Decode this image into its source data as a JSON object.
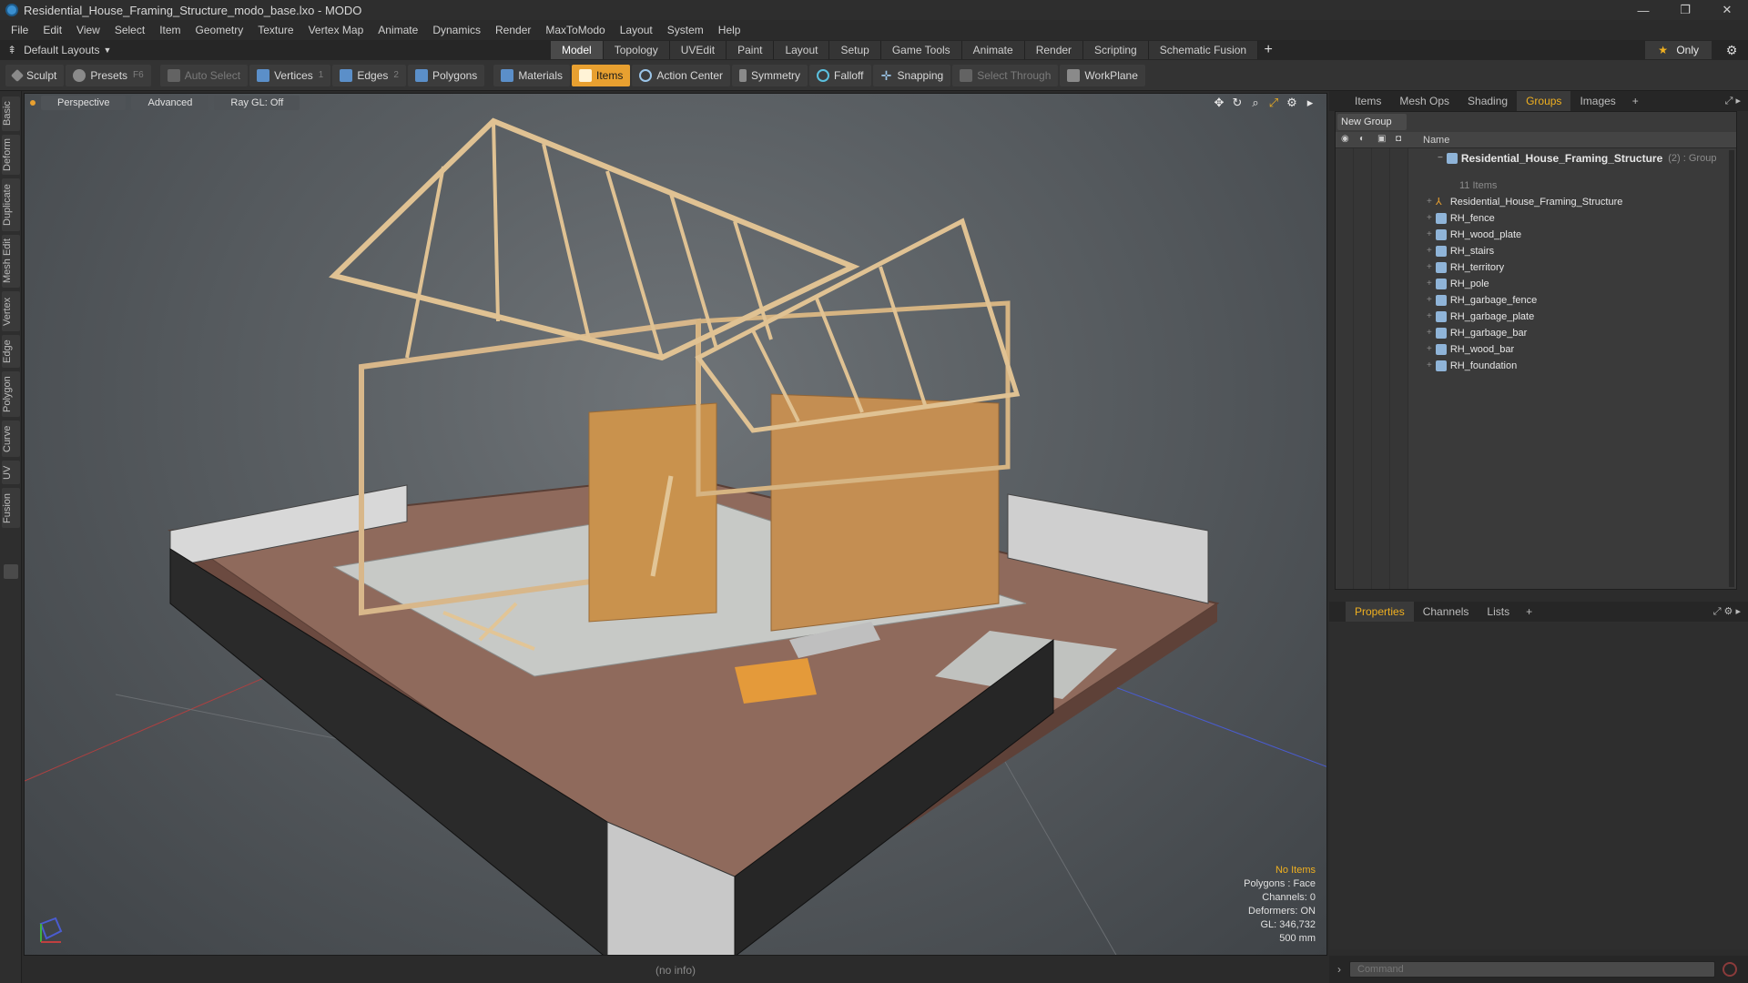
{
  "window": {
    "title": "Residential_House_Framing_Structure_modo_base.lxo - MODO",
    "minimize": "—",
    "restore": "❐",
    "close": "✕"
  },
  "menu": [
    "File",
    "Edit",
    "View",
    "Select",
    "Item",
    "Geometry",
    "Texture",
    "Vertex Map",
    "Animate",
    "Dynamics",
    "Render",
    "MaxToModo",
    "Layout",
    "System",
    "Help"
  ],
  "layout_bar": {
    "layout_name": "Default Layouts",
    "modes": [
      "Model",
      "Topology",
      "UVEdit",
      "Paint",
      "Layout",
      "Setup",
      "Game Tools",
      "Animate",
      "Render",
      "Scripting",
      "Schematic Fusion"
    ],
    "active_mode": "Model",
    "add_label": "+",
    "only_label": "Only"
  },
  "toolbar": {
    "sculpt": "Sculpt",
    "presets": "Presets",
    "presets_key": "F6",
    "auto_select": "Auto Select",
    "vertices": "Vertices",
    "vertices_key": "1",
    "edges": "Edges",
    "edges_key": "2",
    "polygons": "Polygons",
    "materials": "Materials",
    "items": "Items",
    "action_center": "Action Center",
    "symmetry": "Symmetry",
    "falloff": "Falloff",
    "snapping": "Snapping",
    "select_through": "Select Through",
    "workplane": "WorkPlane"
  },
  "left_tabs": [
    "Basic",
    "Deform",
    "Duplicate",
    "Mesh Edit",
    "Vertex",
    "Edge",
    "Polygon",
    "Curve",
    "UV",
    "Fusion"
  ],
  "viewport": {
    "view_mode": "Perspective",
    "shading": "Advanced",
    "raygl": "Ray GL: Off",
    "info": {
      "selection": "No Items",
      "polygons": "Polygons : Face",
      "channels": "Channels: 0",
      "deformers": "Deformers: ON",
      "gl": "GL: 346,732",
      "scale": "500 mm"
    }
  },
  "status": {
    "info": "(no info)"
  },
  "right_panel": {
    "tabs": [
      "Items",
      "Mesh Ops",
      "Shading",
      "Groups",
      "Images"
    ],
    "active_tab": "Groups",
    "new_group": "New Group",
    "name_col": "Name",
    "group": {
      "name": "Residential_House_Framing_Structure",
      "suffix": "(2) : Group",
      "count": "11 Items"
    },
    "items": [
      {
        "name": "Residential_House_Framing_Structure",
        "icon": "locator-icon"
      },
      {
        "name": "RH_fence",
        "icon": "mesh-icon"
      },
      {
        "name": "RH_wood_plate",
        "icon": "mesh-icon"
      },
      {
        "name": "RH_stairs",
        "icon": "mesh-icon"
      },
      {
        "name": "RH_territory",
        "icon": "mesh-icon"
      },
      {
        "name": "RH_pole",
        "icon": "mesh-icon"
      },
      {
        "name": "RH_garbage_fence",
        "icon": "mesh-icon"
      },
      {
        "name": "RH_garbage_plate",
        "icon": "mesh-icon"
      },
      {
        "name": "RH_garbage_bar",
        "icon": "mesh-icon"
      },
      {
        "name": "RH_wood_bar",
        "icon": "mesh-icon"
      },
      {
        "name": "RH_foundation",
        "icon": "mesh-icon"
      }
    ],
    "lower_tabs": [
      "Properties",
      "Channels",
      "Lists"
    ],
    "lower_active": "Properties",
    "command_placeholder": "Command"
  }
}
